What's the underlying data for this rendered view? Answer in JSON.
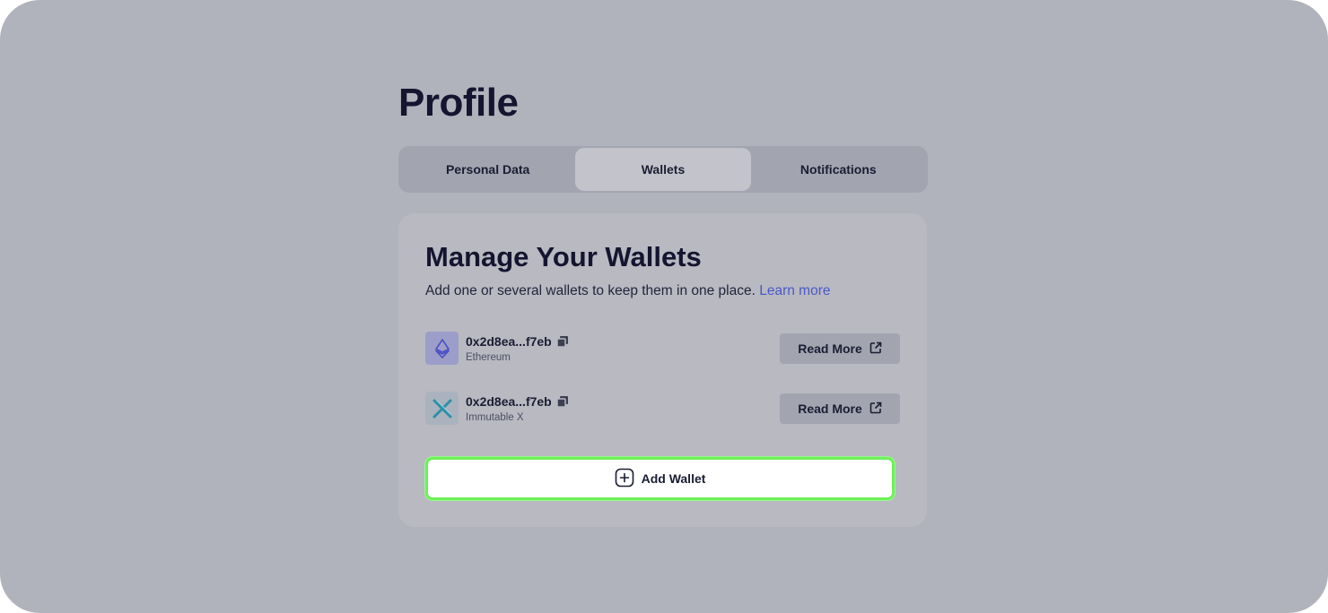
{
  "page": {
    "title": "Profile"
  },
  "tabs": [
    {
      "label": "Personal Data",
      "active": false
    },
    {
      "label": "Wallets",
      "active": true
    },
    {
      "label": "Notifications",
      "active": false
    }
  ],
  "wallets_card": {
    "title": "Manage Your Wallets",
    "description": "Add one or several wallets to keep them in one place.",
    "learn_more_label": "Learn more",
    "wallets": [
      {
        "address": "0x2d8ea...f7eb",
        "network": "Ethereum",
        "icon": "ethereum-icon",
        "read_more_label": "Read More"
      },
      {
        "address": "0x2d8ea...f7eb",
        "network": "Immutable X",
        "icon": "immutable-x-icon",
        "read_more_label": "Read More"
      }
    ],
    "add_wallet_label": "Add Wallet"
  },
  "colors": {
    "background": "#b1b3bc",
    "card": "#b8b9c1",
    "link": "#4b58c8",
    "highlight": "#6ef05a",
    "text": "#1b1d33"
  }
}
